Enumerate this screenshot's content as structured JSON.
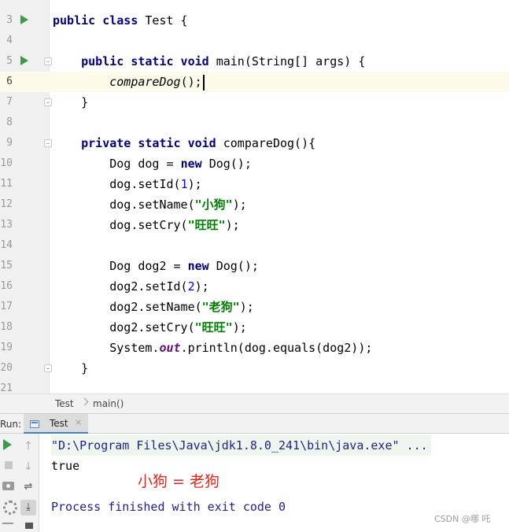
{
  "editor": {
    "lines": [
      {
        "n": "3",
        "tokens": [
          [
            "kw",
            "public class "
          ],
          [
            "p",
            "Test {"
          ]
        ],
        "run": true
      },
      {
        "n": "4",
        "tokens": []
      },
      {
        "n": "5",
        "tokens": [
          [
            "p",
            "    "
          ],
          [
            "kw",
            "public static void "
          ],
          [
            "p",
            "main(String[] args) {"
          ]
        ],
        "run": true,
        "fold": true
      },
      {
        "n": "6",
        "tokens": [
          [
            "p",
            "        "
          ],
          [
            "it",
            "compareDog"
          ],
          [
            "p",
            "();"
          ]
        ],
        "current": true,
        "caret": true
      },
      {
        "n": "7",
        "tokens": [
          [
            "p",
            "    }"
          ]
        ],
        "fold": true
      },
      {
        "n": "8",
        "tokens": []
      },
      {
        "n": "9",
        "tokens": [
          [
            "p",
            "    "
          ],
          [
            "kw",
            "private static void "
          ],
          [
            "p",
            "compareDog(){"
          ]
        ],
        "fold": true
      },
      {
        "n": "10",
        "tokens": [
          [
            "p",
            "        Dog dog = "
          ],
          [
            "kw",
            "new "
          ],
          [
            "p",
            "Dog();"
          ]
        ]
      },
      {
        "n": "11",
        "tokens": [
          [
            "p",
            "        dog.setId("
          ],
          [
            "num",
            "1"
          ],
          [
            "p",
            ");"
          ]
        ]
      },
      {
        "n": "12",
        "tokens": [
          [
            "p",
            "        dog.setName("
          ],
          [
            "str",
            "\"小狗\""
          ],
          [
            "p",
            ");"
          ]
        ]
      },
      {
        "n": "13",
        "tokens": [
          [
            "p",
            "        dog.setCry("
          ],
          [
            "str",
            "\"旺旺\""
          ],
          [
            "p",
            ");"
          ]
        ]
      },
      {
        "n": "14",
        "tokens": []
      },
      {
        "n": "15",
        "tokens": [
          [
            "p",
            "        Dog dog2 = "
          ],
          [
            "kw",
            "new "
          ],
          [
            "p",
            "Dog();"
          ]
        ]
      },
      {
        "n": "16",
        "tokens": [
          [
            "p",
            "        dog2.setId("
          ],
          [
            "num",
            "2"
          ],
          [
            "p",
            ");"
          ]
        ]
      },
      {
        "n": "17",
        "tokens": [
          [
            "p",
            "        dog2.setName("
          ],
          [
            "str",
            "\"老狗\""
          ],
          [
            "p",
            ");"
          ]
        ]
      },
      {
        "n": "18",
        "tokens": [
          [
            "p",
            "        dog2.setCry("
          ],
          [
            "str",
            "\"旺旺\""
          ],
          [
            "p",
            ");"
          ]
        ]
      },
      {
        "n": "19",
        "tokens": [
          [
            "p",
            "        System."
          ],
          [
            "st",
            "out"
          ],
          [
            "p",
            ".println(dog.equals(dog2));"
          ]
        ]
      },
      {
        "n": "20",
        "tokens": [
          [
            "p",
            "    }"
          ]
        ],
        "fold": true
      },
      {
        "n": "21",
        "tokens": []
      }
    ]
  },
  "breadcrumb": {
    "items": [
      "Test",
      "main()"
    ]
  },
  "run_panel": {
    "label": "Run:",
    "tab_label": "Test",
    "close_glyph": "×",
    "toolbar": {
      "up_arrow": "↑",
      "down_arrow": "↓",
      "wrap": "⇌",
      "scroll_end": "⤓"
    },
    "console": {
      "command": "\"D:\\Program Files\\Java\\jdk1.8.0_241\\bin\\java.exe\" ...",
      "output": "true",
      "annotation": "小狗 = 老狗",
      "exit": "Process finished with exit code 0"
    },
    "watermark": "CSDN @哪 吒"
  },
  "colors": {
    "keyword": "#000080",
    "number": "#0000ff",
    "string": "#008000",
    "static_field": "#660e7a",
    "run_icon": "#3d9a4a",
    "annotation": "#e8231c"
  }
}
